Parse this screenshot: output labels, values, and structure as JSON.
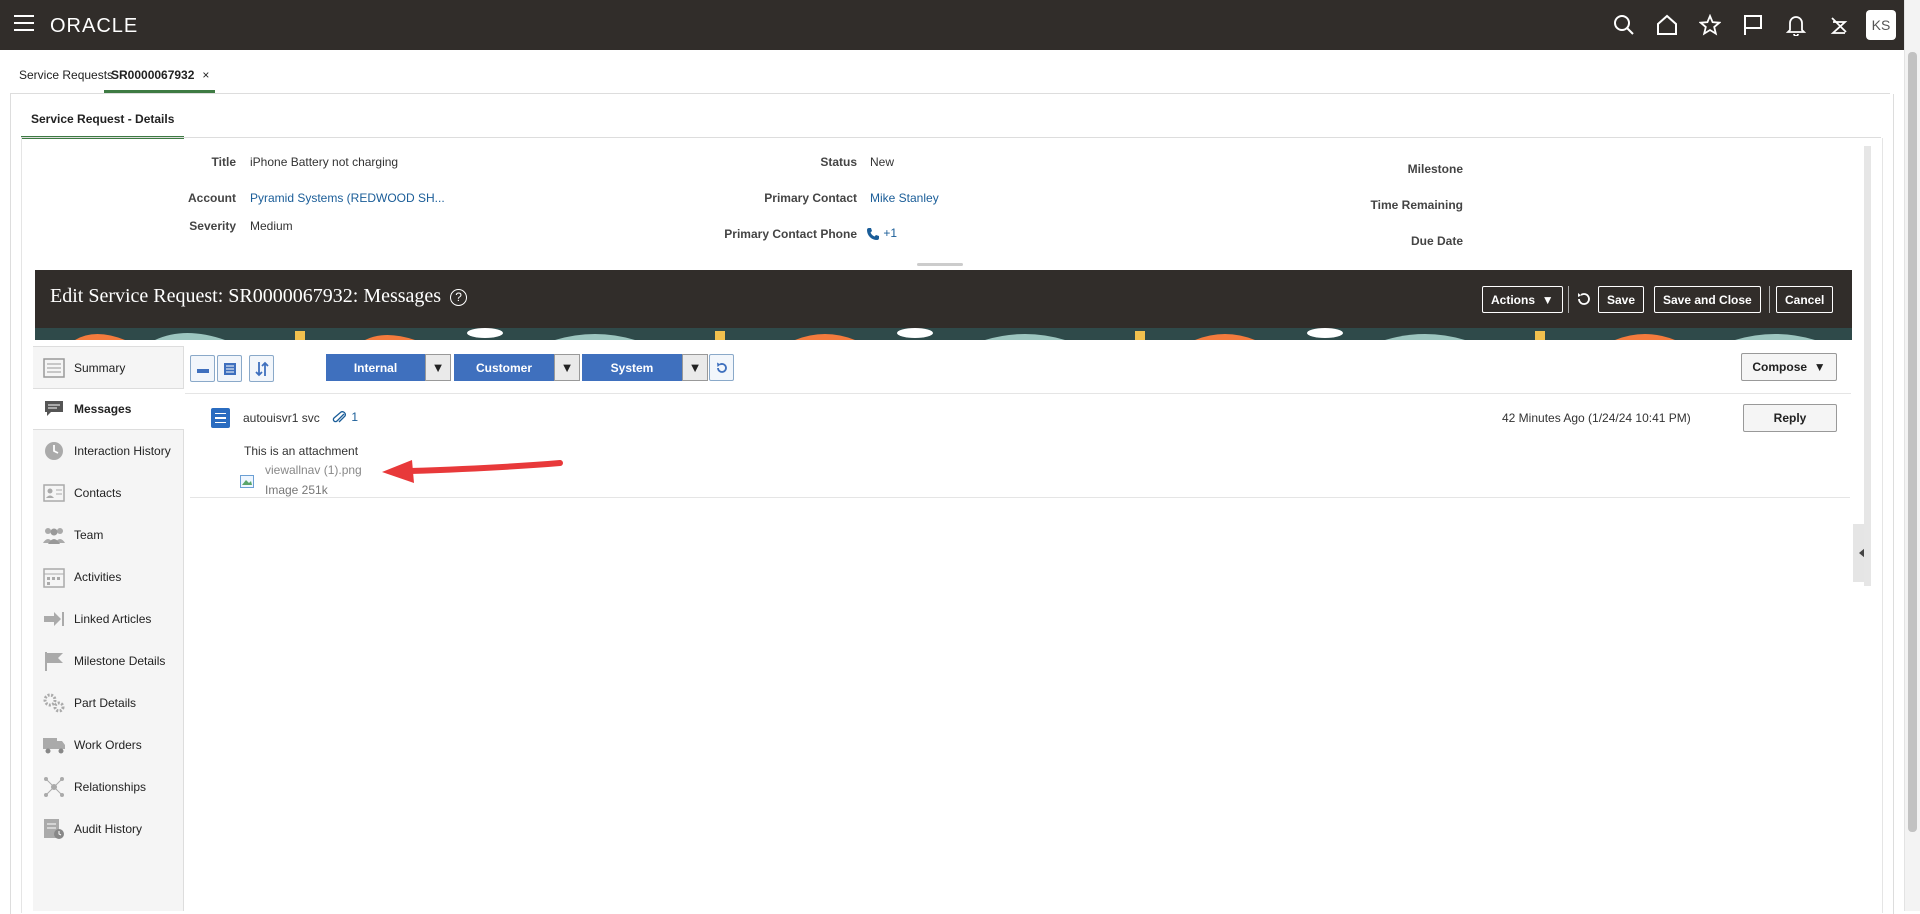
{
  "app": {
    "logo": "ORACLE",
    "avatar_initials": "KS",
    "top_icons": [
      "search-icon",
      "home-icon",
      "star-icon",
      "flag-icon",
      "bell-icon",
      "signout-icon"
    ]
  },
  "page_tabs": {
    "service_requests": "Service Requests",
    "current": "SR0000067932",
    "close": "×"
  },
  "subtab": "Service Request - Details",
  "header": {
    "title_label": "Title",
    "title_value": "iPhone Battery not charging",
    "account_label": "Account",
    "account_value": "Pyramid Systems (REDWOOD SH...",
    "severity_label": "Severity",
    "severity_value": "Medium",
    "status_label": "Status",
    "status_value": "New",
    "primary_contact_label": "Primary Contact",
    "primary_contact_value": "Mike Stanley",
    "phone_label": "Primary Contact Phone",
    "phone_value": "+1",
    "milestone_label": "Milestone",
    "time_remaining_label": "Time Remaining",
    "due_date_label": "Due Date"
  },
  "edit": {
    "title": "Edit Service Request: SR0000067932",
    "section": ": Messages",
    "help": "?",
    "actions": "Actions",
    "save": "Save",
    "save_close": "Save and Close",
    "cancel": "Cancel"
  },
  "nav": [
    {
      "label": "Summary",
      "icon": "summary-icon"
    },
    {
      "label": "Messages",
      "icon": "messages-icon"
    },
    {
      "label": "Interaction History",
      "icon": "clock-icon"
    },
    {
      "label": "Contacts",
      "icon": "contact-card-icon"
    },
    {
      "label": "Team",
      "icon": "team-icon"
    },
    {
      "label": "Activities",
      "icon": "calendar-icon"
    },
    {
      "label": "Linked Articles",
      "icon": "link-arrow-icon"
    },
    {
      "label": "Milestone Details",
      "icon": "flag-icon"
    },
    {
      "label": "Part Details",
      "icon": "gears-icon"
    },
    {
      "label": "Work Orders",
      "icon": "truck-icon"
    },
    {
      "label": "Relationships",
      "icon": "network-icon"
    },
    {
      "label": "Audit History",
      "icon": "audit-icon"
    }
  ],
  "filters": {
    "internal": "Internal",
    "customer": "Customer",
    "system": "System",
    "compose": "Compose"
  },
  "message": {
    "author": "autouisvr1 svc",
    "attachment_count": "1",
    "time": "42 Minutes Ago (1/24/24 10:41 PM)",
    "reply": "Reply",
    "body": "This is an attachment",
    "file_name": "viewallnav (1).png",
    "file_info": "Image 251k"
  },
  "colors": {
    "accent_green": "#3e7b43",
    "filter_blue": "#3f70be",
    "link_blue": "#1a5d98",
    "header_dark": "#312d2a",
    "arrow_red": "#e8393a"
  }
}
